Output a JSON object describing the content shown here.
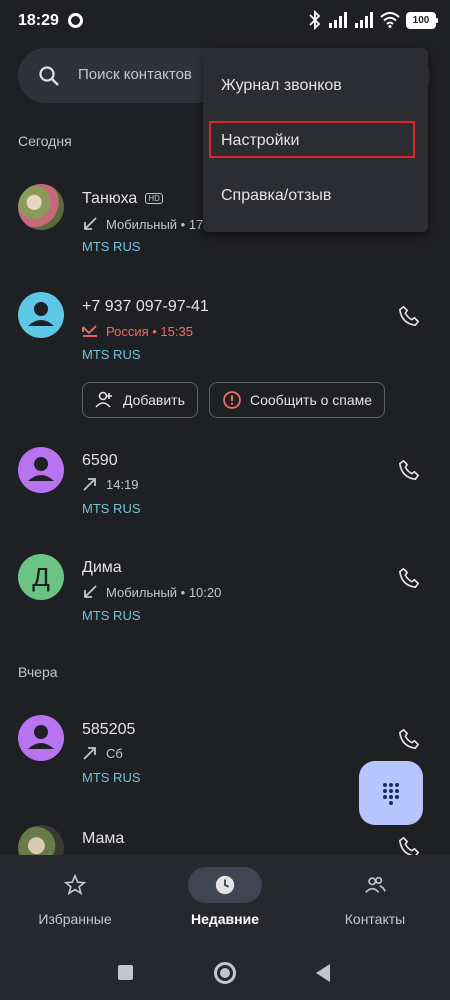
{
  "status": {
    "time": "18:29",
    "battery": "100"
  },
  "search": {
    "placeholder": "Поиск контактов"
  },
  "menu": {
    "items": [
      "Журнал звонков",
      "Настройки",
      "Справка/отзыв"
    ]
  },
  "sections": {
    "today": "Сегодня",
    "yesterday": "Вчера"
  },
  "calls": [
    {
      "name": "Танюха",
      "badge": "HD",
      "detail": "Мобильный • 17",
      "carrier": "MTS RUS",
      "direction": "incoming"
    },
    {
      "name": "+7 937 097-97-41",
      "detail": "Россия • 15:35",
      "carrier": "MTS RUS",
      "direction": "missed"
    },
    {
      "name": "6590",
      "detail": "14:19",
      "carrier": "MTS RUS",
      "direction": "outgoing"
    },
    {
      "name": "Дима",
      "avatar_letter": "Д",
      "detail": "Мобильный • 10:20",
      "carrier": "MTS RUS",
      "direction": "incoming"
    },
    {
      "name": "585205",
      "detail": "Сб",
      "carrier": "MTS RUS",
      "direction": "outgoing"
    },
    {
      "name": "Мама"
    }
  ],
  "actions": {
    "add": "Добавить",
    "spam": "Сообщить о спаме"
  },
  "nav": [
    {
      "label": "Избранные",
      "icon": "star-icon"
    },
    {
      "label": "Недавние",
      "icon": "clock-icon",
      "active": true
    },
    {
      "label": "Контакты",
      "icon": "people-icon"
    }
  ],
  "colors": {
    "accent": "#b8c6ff",
    "carrier": "#6fc4d8",
    "missed": "#ee6e66",
    "highlight": "#e0242a"
  }
}
